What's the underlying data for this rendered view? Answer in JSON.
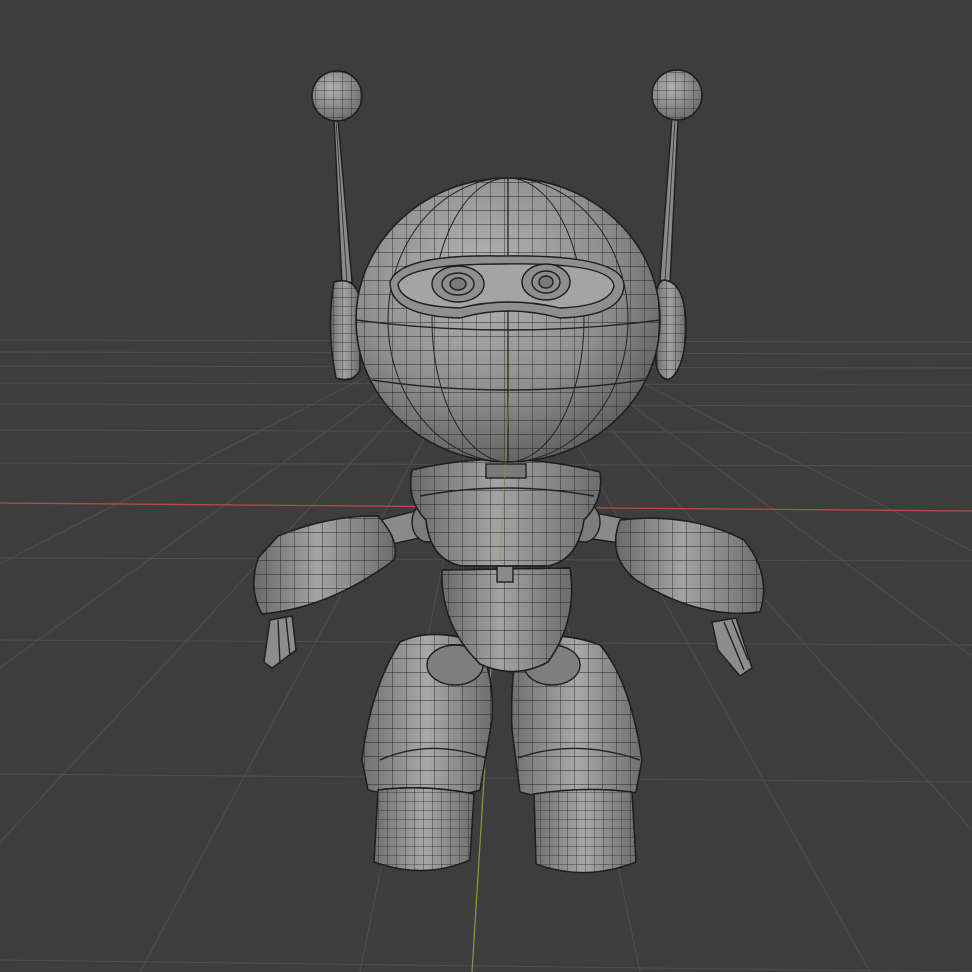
{
  "viewport": {
    "type": "3d-viewport",
    "background_color": "#3d3d3d",
    "grid_color": "#4e4e4e",
    "x_axis_color": "#b64a4a",
    "y_axis_color": "#7fa03a",
    "mesh_color": "#8c8c8c",
    "wire_color": "#1e1e1e"
  },
  "object": {
    "name": "robot",
    "display": "solid-with-wireframe",
    "parts": [
      "head",
      "antenna-left",
      "antenna-right",
      "ear-left",
      "ear-right",
      "visor",
      "eye-left",
      "eye-right",
      "neck",
      "torso",
      "pelvis",
      "arm-left",
      "arm-right",
      "hand-left",
      "hand-right",
      "leg-left",
      "leg-right",
      "foot-left",
      "foot-right"
    ]
  }
}
